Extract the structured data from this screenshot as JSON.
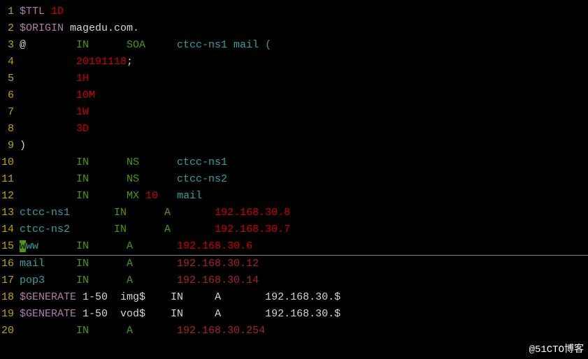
{
  "lines": [
    {
      "no": "1",
      "segs": [
        {
          "t": "$TTL ",
          "c": "c-magenta"
        },
        {
          "t": "1D",
          "c": "c-red"
        }
      ]
    },
    {
      "no": "2",
      "segs": [
        {
          "t": "$ORIGIN ",
          "c": "c-magenta"
        },
        {
          "t": "magedu.com.",
          "c": "c-white"
        }
      ]
    },
    {
      "no": "3",
      "segs": [
        {
          "t": "@        ",
          "c": "c-white"
        },
        {
          "t": "IN      ",
          "c": "c-green"
        },
        {
          "t": "SOA     ",
          "c": "c-green"
        },
        {
          "t": "ctcc-ns1 mail (",
          "c": "c-cyan"
        }
      ]
    },
    {
      "no": "4",
      "segs": [
        {
          "t": "         ",
          "c": "c-white"
        },
        {
          "t": "20191118",
          "c": "c-red"
        },
        {
          "t": ";",
          "c": "c-white"
        }
      ]
    },
    {
      "no": "5",
      "segs": [
        {
          "t": "         ",
          "c": "c-white"
        },
        {
          "t": "1H",
          "c": "c-red"
        }
      ]
    },
    {
      "no": "6",
      "segs": [
        {
          "t": "         ",
          "c": "c-white"
        },
        {
          "t": "10M",
          "c": "c-red"
        }
      ]
    },
    {
      "no": "7",
      "segs": [
        {
          "t": "         ",
          "c": "c-white"
        },
        {
          "t": "1W",
          "c": "c-red"
        }
      ]
    },
    {
      "no": "8",
      "segs": [
        {
          "t": "         ",
          "c": "c-white"
        },
        {
          "t": "3D",
          "c": "c-red"
        }
      ]
    },
    {
      "no": "9",
      "segs": [
        {
          "t": ")",
          "c": "c-white"
        }
      ]
    },
    {
      "no": "10",
      "segs": [
        {
          "t": "         ",
          "c": "c-white"
        },
        {
          "t": "IN      ",
          "c": "c-green"
        },
        {
          "t": "NS      ",
          "c": "c-green"
        },
        {
          "t": "ctcc-ns1",
          "c": "c-cyan"
        }
      ]
    },
    {
      "no": "11",
      "segs": [
        {
          "t": "         ",
          "c": "c-white"
        },
        {
          "t": "IN      ",
          "c": "c-green"
        },
        {
          "t": "NS      ",
          "c": "c-green"
        },
        {
          "t": "ctcc-ns2",
          "c": "c-cyan"
        }
      ]
    },
    {
      "no": "12",
      "segs": [
        {
          "t": "         ",
          "c": "c-white"
        },
        {
          "t": "IN      ",
          "c": "c-green"
        },
        {
          "t": "MX ",
          "c": "c-green"
        },
        {
          "t": "10   ",
          "c": "c-red"
        },
        {
          "t": "mail",
          "c": "c-cyan"
        }
      ]
    },
    {
      "no": "13",
      "segs": [
        {
          "t": "ctcc-ns1       ",
          "c": "c-cyan"
        },
        {
          "t": "IN      ",
          "c": "c-green"
        },
        {
          "t": "A       ",
          "c": "c-green"
        },
        {
          "t": "192.168.30.8",
          "c": "c-red"
        }
      ]
    },
    {
      "no": "14",
      "segs": [
        {
          "t": "ctcc-ns2       ",
          "c": "c-cyan"
        },
        {
          "t": "IN      ",
          "c": "c-green"
        },
        {
          "t": "A       ",
          "c": "c-green"
        },
        {
          "t": "192.168.30.7",
          "c": "c-red"
        }
      ]
    },
    {
      "no": "15",
      "underline": true,
      "segs": [
        {
          "t": "w",
          "c": "cursor"
        },
        {
          "t": "ww      ",
          "c": "c-cyan"
        },
        {
          "t": "IN      ",
          "c": "c-green"
        },
        {
          "t": "A       ",
          "c": "c-green"
        },
        {
          "t": "192.168.30.6",
          "c": "c-red"
        }
      ]
    },
    {
      "no": "16",
      "segs": [
        {
          "t": "mail     ",
          "c": "c-cyan"
        },
        {
          "t": "IN      ",
          "c": "c-green"
        },
        {
          "t": "A       ",
          "c": "c-green"
        },
        {
          "t": "192.168.30.12",
          "c": "c-darkred"
        }
      ]
    },
    {
      "no": "17",
      "segs": [
        {
          "t": "pop3     ",
          "c": "c-cyan"
        },
        {
          "t": "IN      ",
          "c": "c-green"
        },
        {
          "t": "A       ",
          "c": "c-green"
        },
        {
          "t": "192.168.30.14",
          "c": "c-darkred"
        }
      ]
    },
    {
      "no": "18",
      "segs": [
        {
          "t": "$GENERATE ",
          "c": "c-magenta"
        },
        {
          "t": "1-50  ",
          "c": "c-white"
        },
        {
          "t": "img$    ",
          "c": "c-white"
        },
        {
          "t": "IN     ",
          "c": "c-white"
        },
        {
          "t": "A       ",
          "c": "c-white"
        },
        {
          "t": "192.168.30.$",
          "c": "c-white"
        }
      ]
    },
    {
      "no": "19",
      "segs": [
        {
          "t": "$GENERATE ",
          "c": "c-magenta"
        },
        {
          "t": "1-50  ",
          "c": "c-white"
        },
        {
          "t": "vod$    ",
          "c": "c-white"
        },
        {
          "t": "IN     ",
          "c": "c-white"
        },
        {
          "t": "A       ",
          "c": "c-white"
        },
        {
          "t": "192.168.30.$",
          "c": "c-white"
        }
      ]
    },
    {
      "no": "20",
      "segs": [
        {
          "t": "         ",
          "c": "c-white"
        },
        {
          "t": "IN      ",
          "c": "c-green"
        },
        {
          "t": "A       ",
          "c": "c-green"
        },
        {
          "t": "192.168.30.254",
          "c": "c-darkred"
        }
      ]
    }
  ],
  "watermark": "@51CTO博客"
}
